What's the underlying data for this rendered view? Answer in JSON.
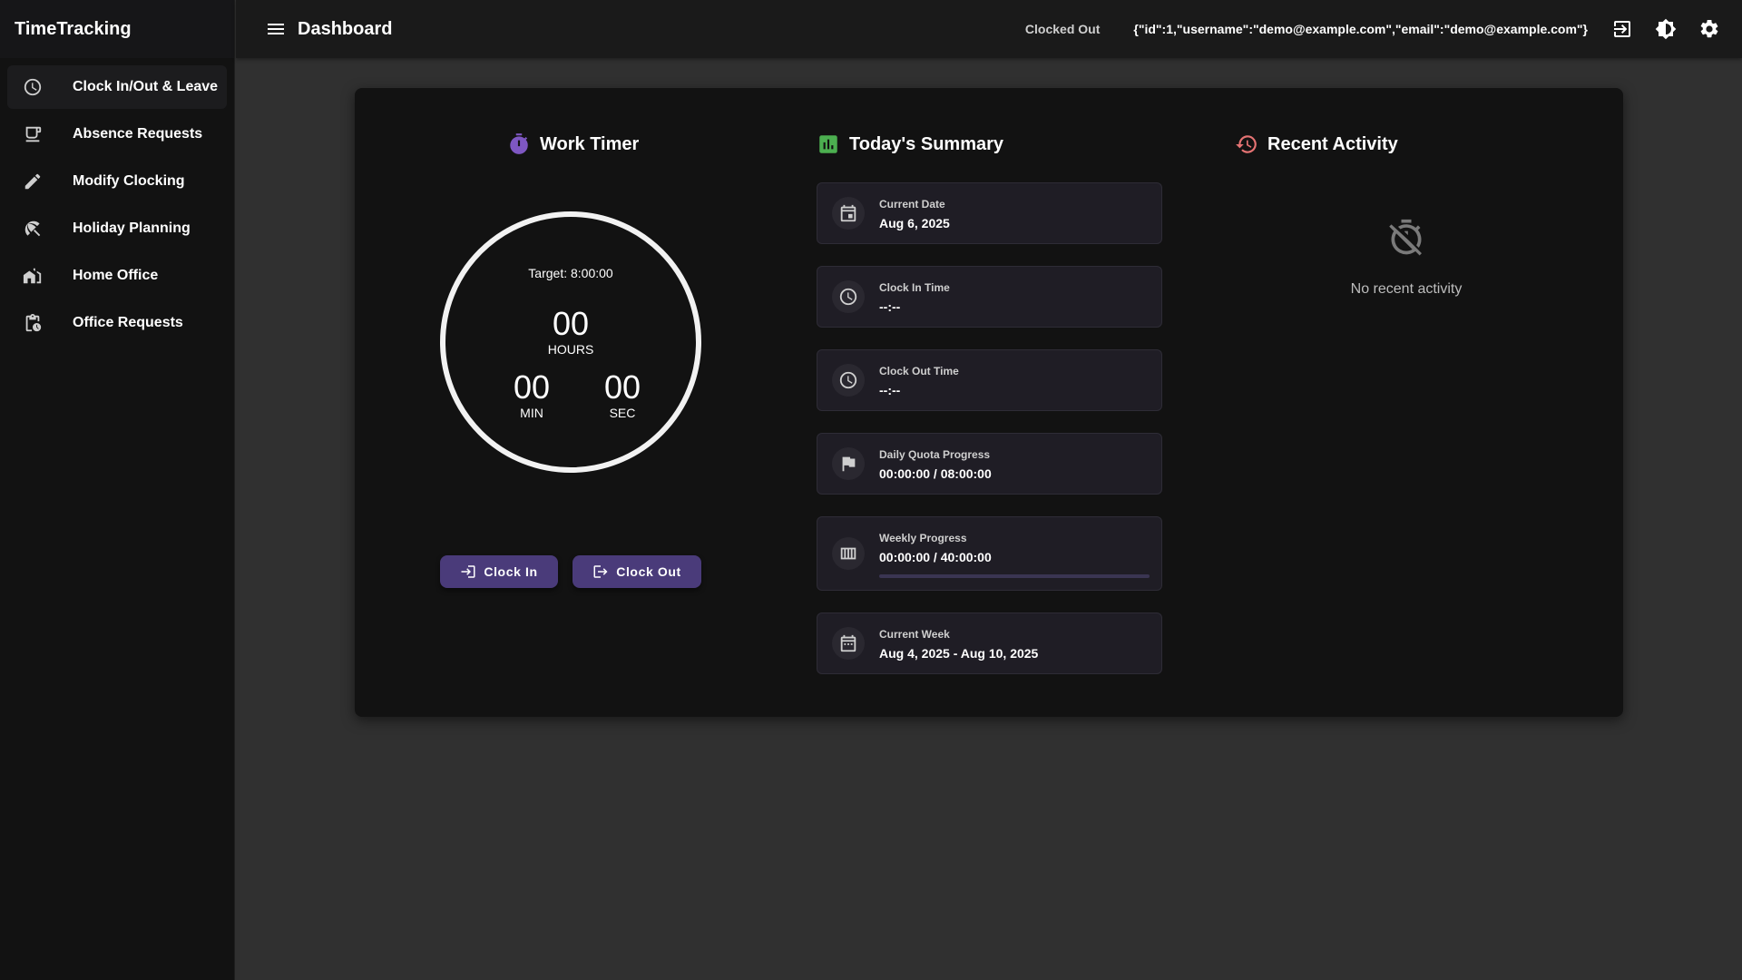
{
  "app": {
    "title": "TimeTracking"
  },
  "sidebar": {
    "items": [
      {
        "label": "Clock In/Out & Leave",
        "icon": "clock-icon",
        "active": true
      },
      {
        "label": "Absence Requests",
        "icon": "coffee-icon",
        "active": false
      },
      {
        "label": "Modify Clocking",
        "icon": "pencil-icon",
        "active": false
      },
      {
        "label": "Holiday Planning",
        "icon": "beach-umbrella-icon",
        "active": false
      },
      {
        "label": "Home Office",
        "icon": "house-icon",
        "active": false
      },
      {
        "label": "Office Requests",
        "icon": "clipboard-clock-icon",
        "active": false
      }
    ]
  },
  "header": {
    "title": "Dashboard",
    "status": "Clocked Out",
    "user": "{\"id\":1,\"username\":\"demo@example.com\",\"email\":\"demo@example.com\"}",
    "icons": [
      "login-icon",
      "brightness-icon",
      "gear-icon"
    ]
  },
  "timer": {
    "title": "Work Timer",
    "target": "Target: 8:00:00",
    "hours": "00",
    "hours_label": "HOURS",
    "minutes": "00",
    "minutes_label": "MIN",
    "seconds": "00",
    "seconds_label": "SEC",
    "clock_in_label": "Clock In",
    "clock_out_label": "Clock Out"
  },
  "summary": {
    "title": "Today's Summary",
    "current_date": {
      "label": "Current Date",
      "value": "Aug 6, 2025"
    },
    "clock_in": {
      "label": "Clock In Time",
      "value": "--:--"
    },
    "clock_out": {
      "label": "Clock Out Time",
      "value": "--:--"
    },
    "daily_quota": {
      "label": "Daily Quota Progress",
      "value": "00:00:00 / 08:00:00"
    },
    "weekly": {
      "label": "Weekly Progress",
      "value": "00:00:00 / 40:00:00",
      "progress": 0
    },
    "current_week": {
      "label": "Current Week",
      "value": "Aug 4, 2025 - Aug 10, 2025"
    }
  },
  "activity": {
    "title": "Recent Activity",
    "empty_text": "No recent activity"
  },
  "colors": {
    "accent": "#4a3b7a",
    "timer_icon": "#7e57c2",
    "summary_icon": "#4caf50",
    "activity_icon": "#e57373"
  }
}
